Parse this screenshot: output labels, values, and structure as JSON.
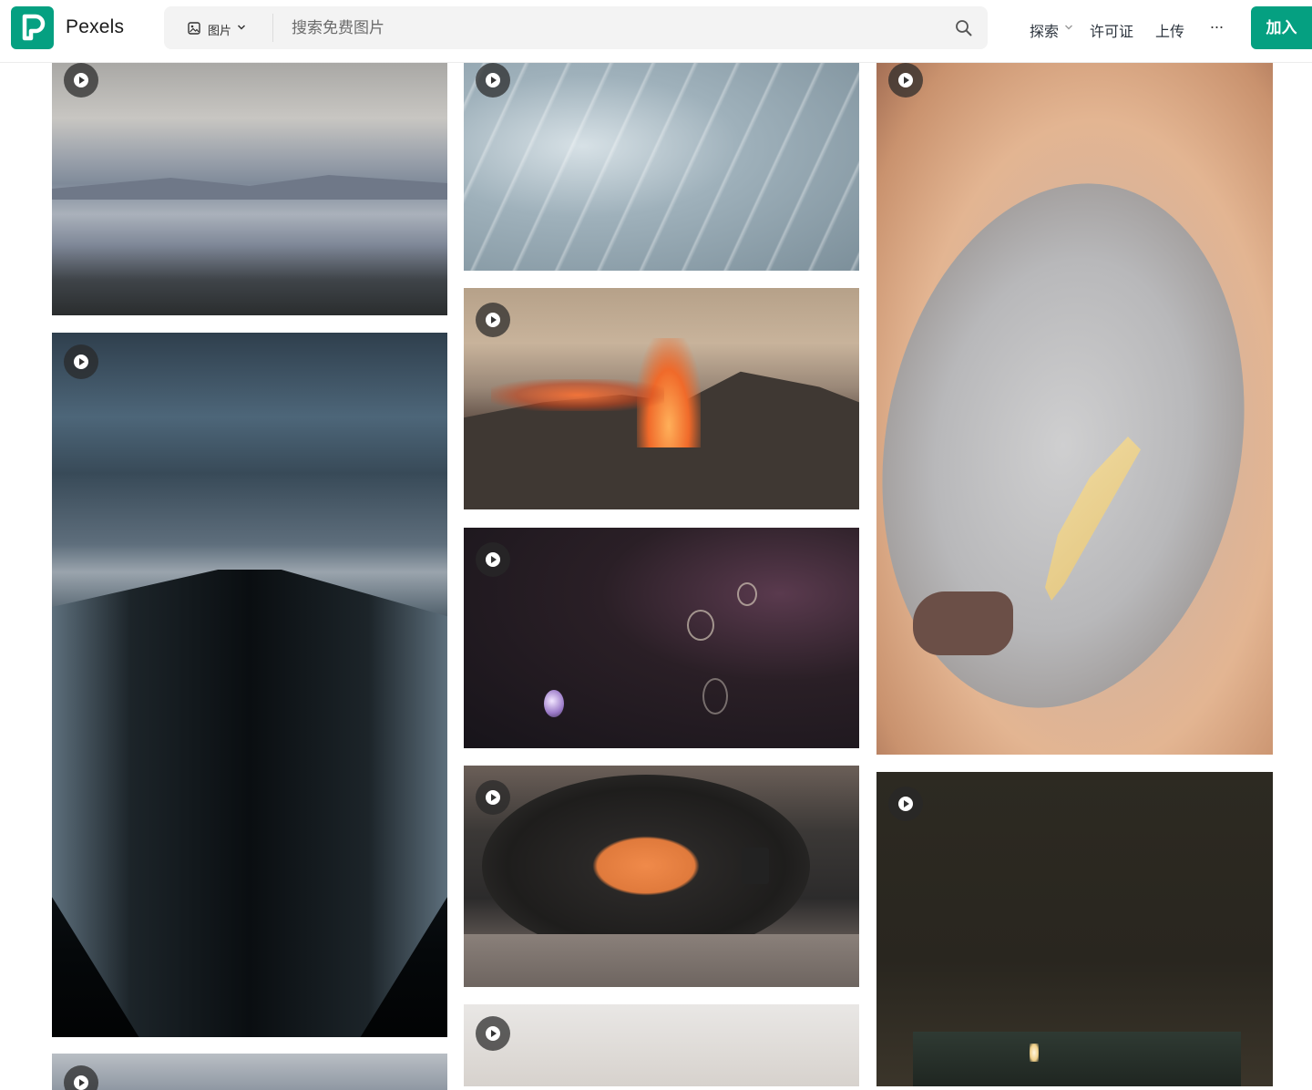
{
  "header": {
    "brand": "Pexels",
    "search": {
      "type_label": "图片",
      "placeholder": "搜索免费图片"
    },
    "nav": {
      "explore": "探索",
      "license": "许可证",
      "upload": "上传",
      "more": "···",
      "join": "加入"
    }
  },
  "colors": {
    "accent": "#05a081"
  },
  "gallery": {
    "columns": 3,
    "items": [
      {
        "id": "mountain-lake",
        "type": "video",
        "icon": "play-icon"
      },
      {
        "id": "escalator",
        "type": "video",
        "icon": "play-icon"
      },
      {
        "id": "cloudy-sky",
        "type": "video",
        "icon": "play-icon"
      },
      {
        "id": "water-surface",
        "type": "video",
        "icon": "play-icon"
      },
      {
        "id": "volcano",
        "type": "video",
        "icon": "play-icon"
      },
      {
        "id": "bubbles",
        "type": "video",
        "icon": "play-icon"
      },
      {
        "id": "record-player",
        "type": "video",
        "icon": "play-icon"
      },
      {
        "id": "sunset-beach",
        "type": "video",
        "icon": "play-icon"
      },
      {
        "id": "mirror-feather",
        "type": "video",
        "icon": "play-icon"
      },
      {
        "id": "candle-book",
        "type": "video",
        "icon": "play-icon"
      }
    ]
  }
}
